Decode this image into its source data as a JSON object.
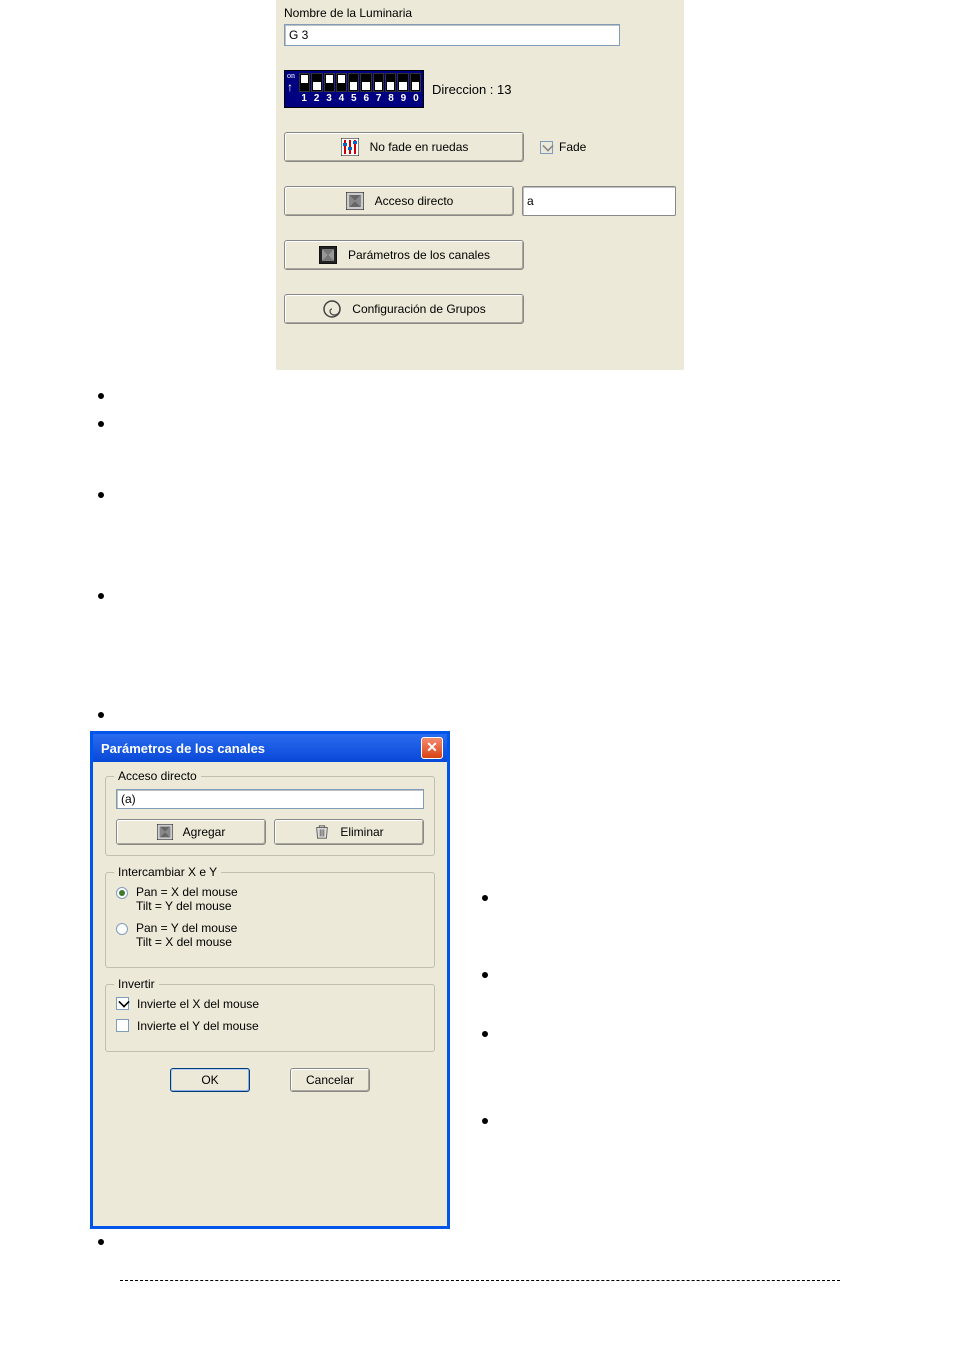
{
  "topPanel": {
    "nameLabel": "Nombre de la Luminaria",
    "nameValue": "G 3",
    "direccionLabel": "Direccion : 13",
    "dipNumbers": [
      "1",
      "2",
      "3",
      "4",
      "5",
      "6",
      "7",
      "8",
      "9",
      "0"
    ],
    "noFadeBtn": "No fade en ruedas",
    "fadeLabel": "Fade",
    "accesoBtn": "Acceso directo",
    "accesoValue": "a",
    "parametrosBtn": "Parámetros de los canales",
    "gruposBtn": "Configuración de Grupos"
  },
  "dialog": {
    "title": "Parámetros de los canales",
    "accesoGroup": "Acceso directo",
    "accesoValue": "(a)",
    "agregarBtn": "Agregar",
    "eliminarBtn": "Eliminar",
    "intercambiarGroup": "Intercambiar X e Y",
    "radio1a": "Pan = X del mouse",
    "radio1b": "Tilt = Y del mouse",
    "radio2a": "Pan = Y del mouse",
    "radio2b": "Tilt = X del mouse",
    "invertirGroup": "Invertir",
    "invX": "Invierte el X del mouse",
    "invY": "Invierte el Y del mouse",
    "okBtn": "OK",
    "cancelBtn": "Cancelar"
  }
}
